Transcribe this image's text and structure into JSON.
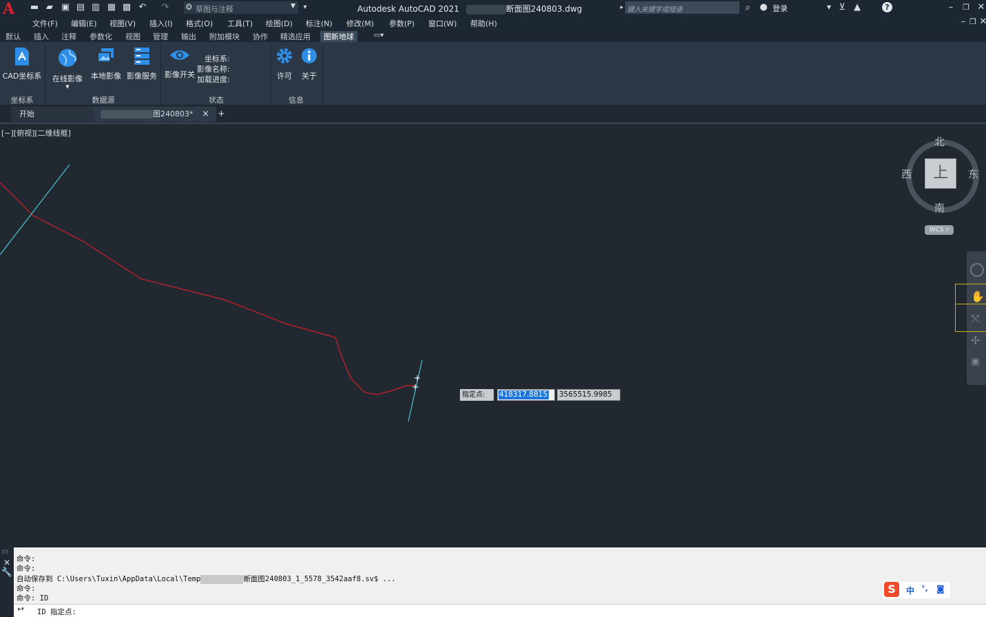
{
  "app": {
    "title": "Autodesk AutoCAD 2021",
    "doc_title": "断面图240803.dwg",
    "workspace": "草图与注释",
    "search_placeholder": "键入关键字或短语",
    "login": "登录",
    "logo_letter": "A"
  },
  "menu": [
    "文件(F)",
    "编辑(E)",
    "视图(V)",
    "插入(I)",
    "格式(O)",
    "工具(T)",
    "绘图(D)",
    "标注(N)",
    "修改(M)",
    "参数(P)",
    "窗口(W)",
    "帮助(H)"
  ],
  "ribbon_tabs": [
    "默认",
    "插入",
    "注释",
    "参数化",
    "视图",
    "管理",
    "输出",
    "附加模块",
    "协作",
    "精选应用",
    "图新地球"
  ],
  "ribbon": {
    "panels": {
      "coord": {
        "label": "坐标系",
        "cad_coord": "CAD坐标系"
      },
      "source": {
        "label": "数据源",
        "online": "在线影像",
        "local": "本地影像",
        "service": "影像服务"
      },
      "status": {
        "label": "状态",
        "toggle": "影像开关",
        "coord_sys": "坐标系:",
        "image_name": "影像名称:",
        "progress": "加载进度:"
      },
      "info": {
        "label": "信息",
        "license": "许可",
        "about": "关于"
      }
    }
  },
  "doc_tabs": {
    "start": "开始",
    "drawing": "图240803*",
    "close": "×",
    "add": "+"
  },
  "viewport": {
    "label": "[−][俯视][二维线框]"
  },
  "viewcube": {
    "north": "北",
    "south": "南",
    "east": "东",
    "west": "西",
    "top": "上",
    "wcs": "WCS"
  },
  "dynamic_input": {
    "prompt": "指定点:",
    "x": "418317.8815",
    "y": "3565515.9985"
  },
  "command": {
    "lines": [
      "命令:",
      "命令:",
      "自动保存到 C:\\Users\\Tuxin\\AppData\\Local\\Temp",
      "命令:",
      "命令: ID"
    ],
    "autosave_tail": "断面图240803_1_5578_3542aaf8.sv$ ...",
    "prompt": "ID 指定点:"
  },
  "ime": {
    "lang": "中",
    "punct": "°,",
    "icon": "S"
  },
  "colors": {
    "red_line": "#d1202a",
    "cyan_line": "#46c7d6",
    "accent": "#1e88e5"
  }
}
